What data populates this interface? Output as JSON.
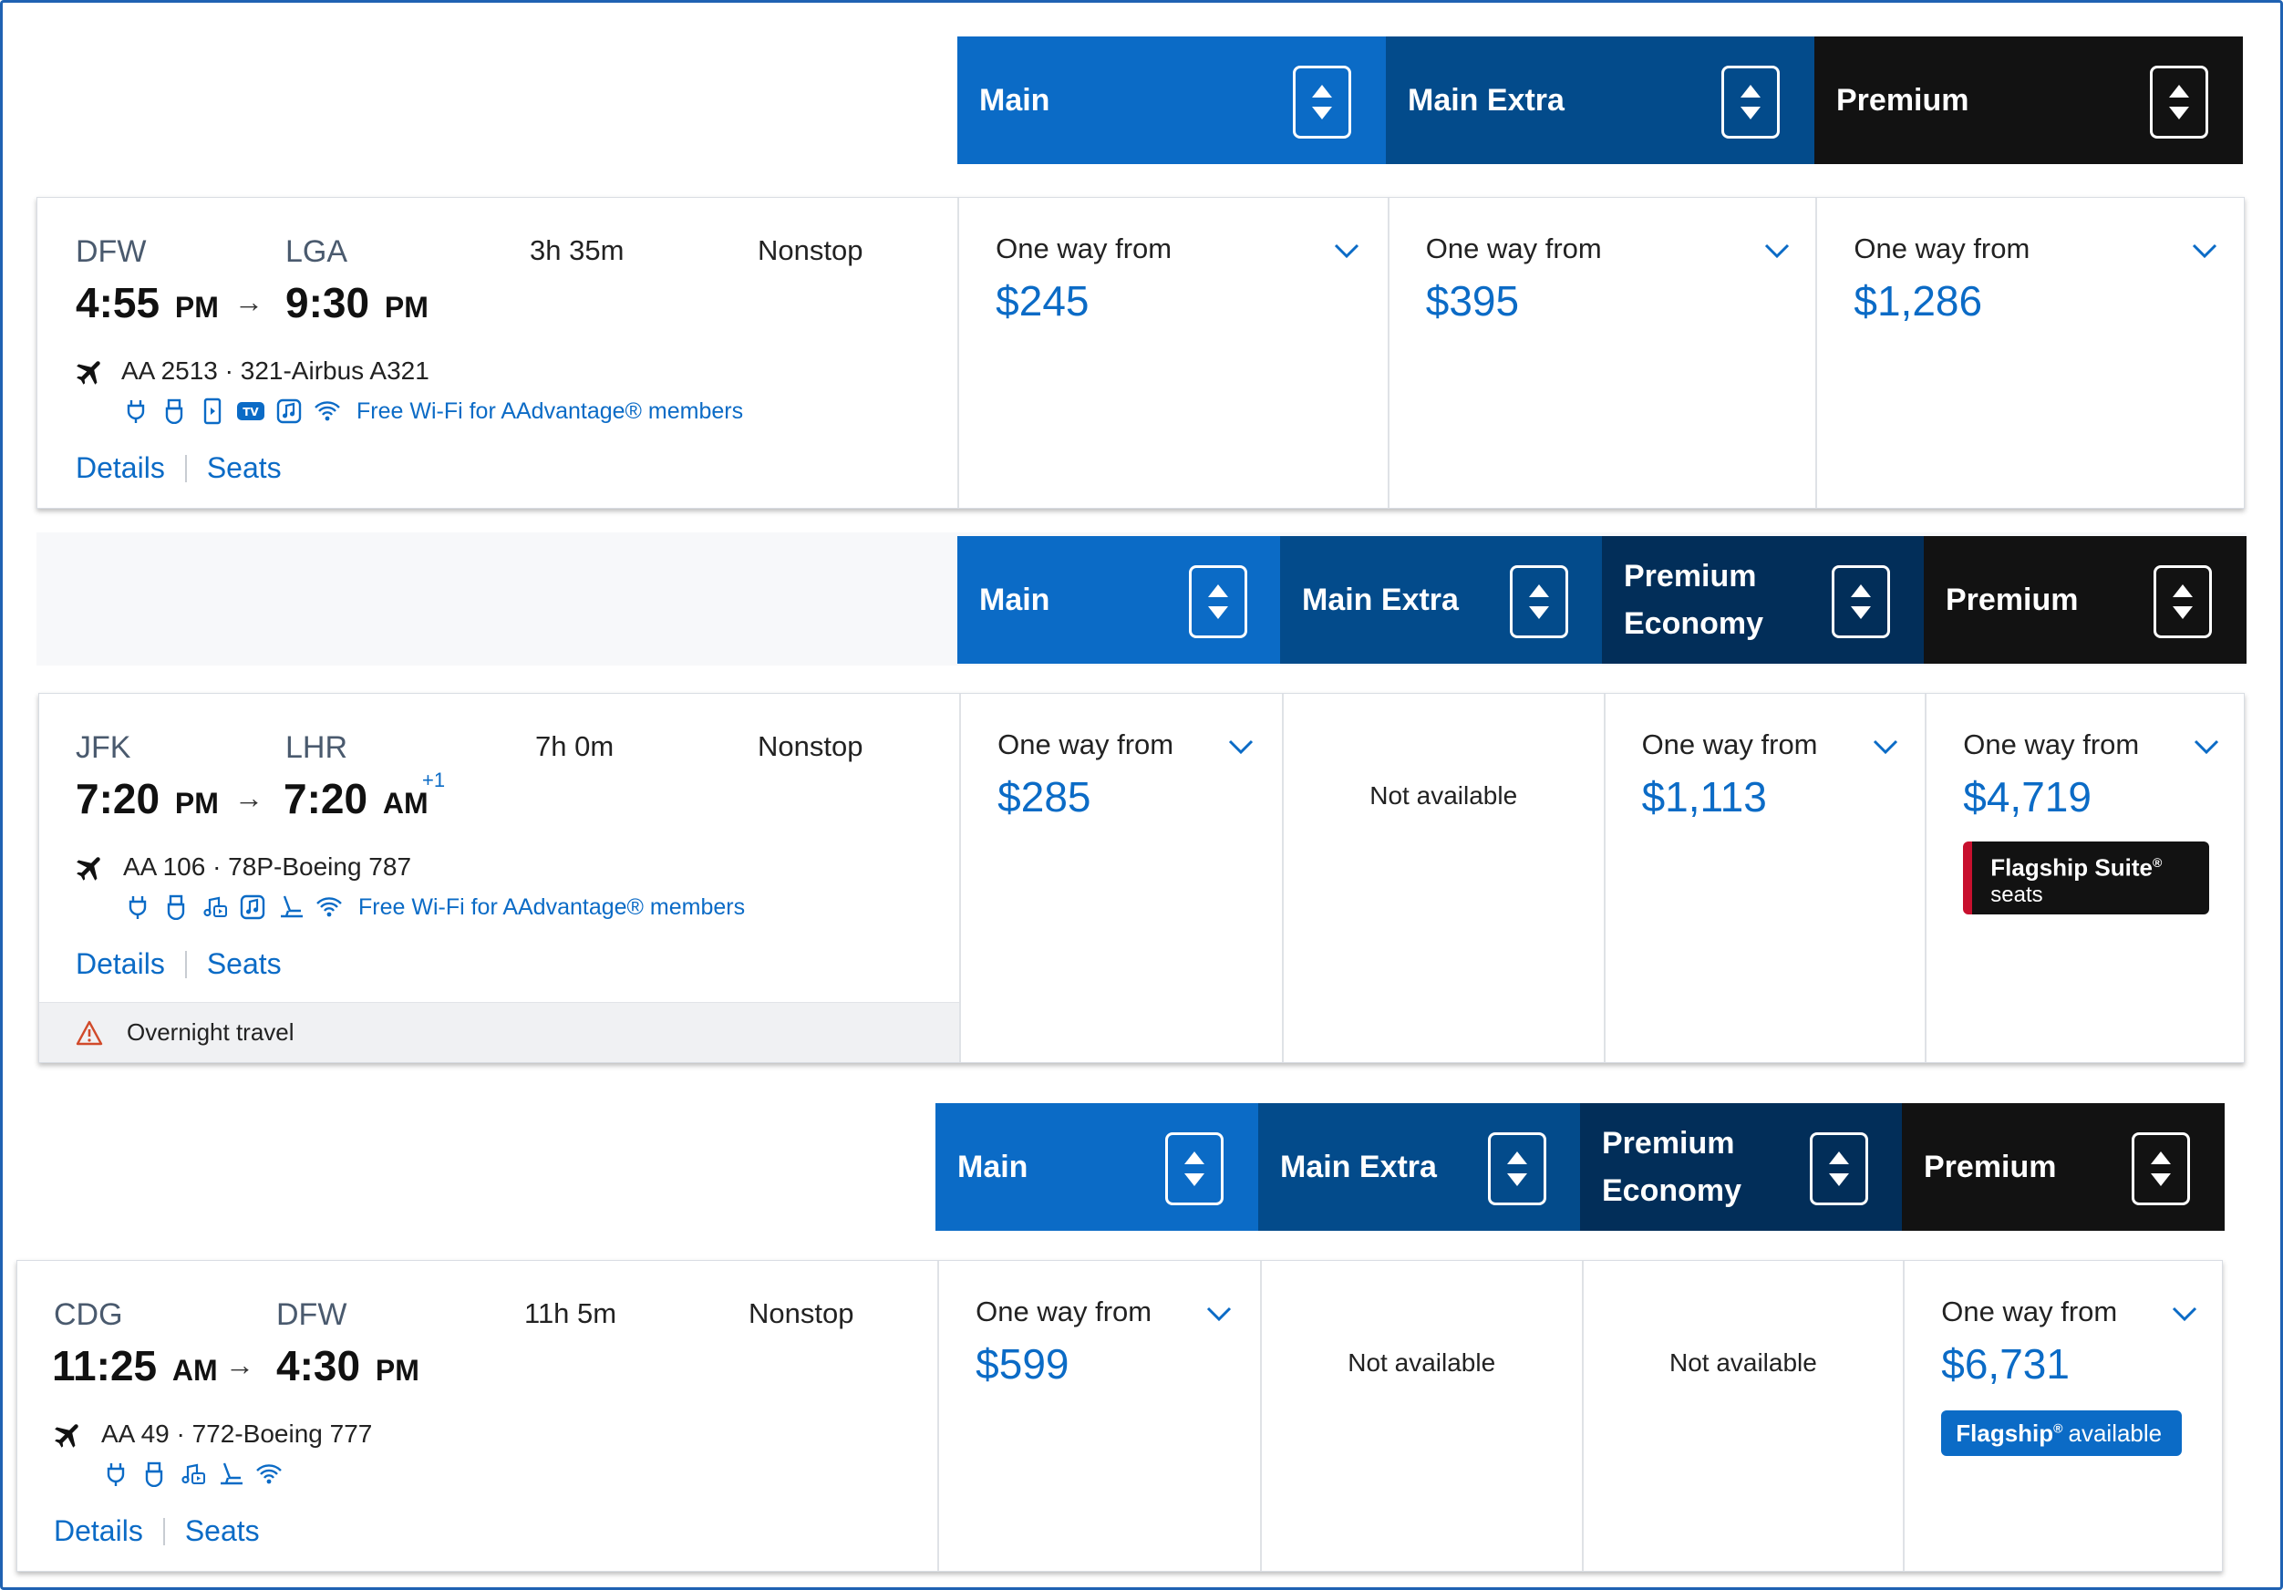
{
  "colors": {
    "main": "#0b6bc6",
    "main_extra": "#034b8b",
    "premium_economy": "#022e59",
    "premium": "#121212",
    "link": "#0b6bc6",
    "suite_accent": "#c8102e"
  },
  "flights": [
    {
      "cabins": [
        "Main",
        "Main Extra",
        "Premium"
      ],
      "origin": "DFW",
      "destination": "LGA",
      "duration": "3h 35m",
      "stops": "Nonstop",
      "depart_time": "4:55",
      "depart_ampm": "PM",
      "arrive_time": "9:30",
      "arrive_ampm": "PM",
      "day_offset": "",
      "flight": "AA 2513 · 321-Airbus A321",
      "amenity_icons": [
        "power-outlet-icon",
        "usb-icon",
        "device-entertainment-icon",
        "tv-icon",
        "music-icon",
        "wifi-icon"
      ],
      "wifi_text": "Free Wi-Fi for AAdvantage® members",
      "details_label": "Details",
      "seats_label": "Seats",
      "overnight_text": "",
      "fares": [
        {
          "label": "One way from",
          "price": "$245"
        },
        {
          "label": "One way from",
          "price": "$395"
        },
        {
          "label": "One way from",
          "price": "$1,286"
        }
      ]
    },
    {
      "cabins": [
        "Main",
        "Main Extra",
        "Premium Economy",
        "Premium"
      ],
      "origin": "JFK",
      "destination": "LHR",
      "duration": "7h 0m",
      "stops": "Nonstop",
      "depart_time": "7:20",
      "depart_ampm": "PM",
      "arrive_time": "7:20",
      "arrive_ampm": "AM",
      "day_offset": "+1",
      "flight": "AA 106 · 78P-Boeing 787",
      "amenity_icons": [
        "power-outlet-icon",
        "usb-icon",
        "on-demand-entertainment-icon",
        "music-icon",
        "lie-flat-seat-icon",
        "wifi-icon"
      ],
      "wifi_text": "Free Wi-Fi for AAdvantage® members",
      "details_label": "Details",
      "seats_label": "Seats",
      "overnight_text": "Overnight travel",
      "fares": [
        {
          "label": "One way from",
          "price": "$285"
        },
        {
          "na": "Not available"
        },
        {
          "label": "One way from",
          "price": "$1,113"
        },
        {
          "label": "One way from",
          "price": "$4,719",
          "badge_type": "suite",
          "badge_bold": "Flagship Suite",
          "badge_text": "seats"
        }
      ]
    },
    {
      "cabins": [
        "Main",
        "Main Extra",
        "Premium Economy",
        "Premium"
      ],
      "origin": "CDG",
      "destination": "DFW",
      "duration": "11h 5m",
      "stops": "Nonstop",
      "depart_time": "11:25",
      "depart_ampm": "AM",
      "arrive_time": "4:30",
      "arrive_ampm": "PM",
      "day_offset": "",
      "flight": "AA 49 · 772-Boeing 777",
      "amenity_icons": [
        "power-outlet-icon",
        "usb-icon",
        "on-demand-entertainment-icon",
        "lie-flat-seat-icon",
        "wifi-icon"
      ],
      "wifi_text": "",
      "details_label": "Details",
      "seats_label": "Seats",
      "overnight_text": "",
      "fares": [
        {
          "label": "One way from",
          "price": "$599"
        },
        {
          "na": "Not available"
        },
        {
          "na": "Not available"
        },
        {
          "label": "One way from",
          "price": "$6,731",
          "badge_type": "flagship",
          "badge_bold": "Flagship",
          "badge_text": "available"
        }
      ]
    }
  ]
}
